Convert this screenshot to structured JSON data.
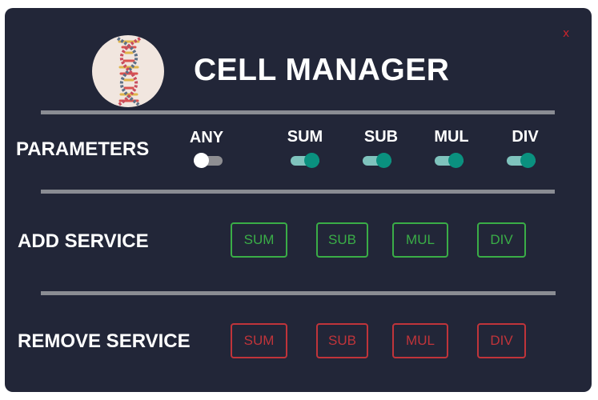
{
  "app": {
    "title": "CELL MANAGER",
    "close_label": "x",
    "logo_icon": "dna-icon"
  },
  "parameters": {
    "label": "PARAMETERS",
    "toggles": [
      {
        "label": "ANY",
        "on": false
      },
      {
        "label": "SUM",
        "on": true
      },
      {
        "label": "SUB",
        "on": true
      },
      {
        "label": "MUL",
        "on": true
      },
      {
        "label": "DIV",
        "on": true
      }
    ]
  },
  "add_service": {
    "label": "ADD SERVICE",
    "buttons": [
      "SUM",
      "SUB",
      "MUL",
      "DIV"
    ],
    "color": "#3aad47"
  },
  "remove_service": {
    "label": "REMOVE SERVICE",
    "buttons": [
      "SUM",
      "SUB",
      "MUL",
      "DIV"
    ],
    "color": "#c0343a"
  },
  "colors": {
    "background": "#222638",
    "divider": "#8a8c93",
    "toggle_on": "#0a917f",
    "close": "#c8232c"
  }
}
